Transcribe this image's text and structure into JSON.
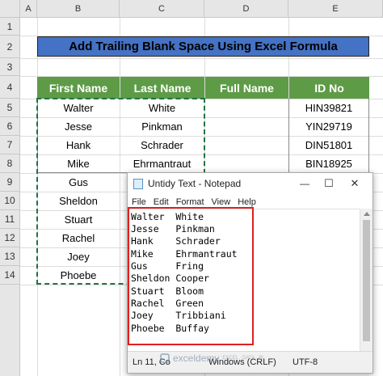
{
  "sheet": {
    "columns": [
      "A",
      "B",
      "C",
      "D",
      "E"
    ],
    "rows": [
      "1",
      "2",
      "3",
      "4",
      "5",
      "6",
      "7",
      "8",
      "9",
      "10",
      "11",
      "12",
      "13",
      "14"
    ],
    "banner": "Add Trailing Blank Space Using Excel Formula",
    "headers": [
      "First Name",
      "Last Name",
      "Full Name",
      "ID No"
    ],
    "data": [
      {
        "first": "Walter",
        "last": "White",
        "id": "HIN39821"
      },
      {
        "first": "Jesse",
        "last": "Pinkman",
        "id": "YIN29719"
      },
      {
        "first": "Hank",
        "last": "Schrader",
        "id": "DIN51801"
      },
      {
        "first": "Mike",
        "last": "Ehrmantraut",
        "id": "BIN18925"
      },
      {
        "first": "Gus",
        "last": "",
        "id": ""
      },
      {
        "first": "Sheldon",
        "last": "",
        "id": ""
      },
      {
        "first": "Stuart",
        "last": "",
        "id": ""
      },
      {
        "first": "Rachel",
        "last": "",
        "id": ""
      },
      {
        "first": "Joey",
        "last": "",
        "id": ""
      },
      {
        "first": "Phoebe",
        "last": "",
        "id": ""
      }
    ],
    "colors": {
      "header_green": "#5e9b47",
      "banner_blue": "#4472c4"
    }
  },
  "notepad": {
    "title": "Untidy Text - Notepad",
    "icon": "notepad-icon",
    "controls": {
      "minimize": "—",
      "maximize": "☐",
      "close": "✕"
    },
    "menu": [
      "File",
      "Edit",
      "Format",
      "View",
      "Help"
    ],
    "lines": [
      "Walter  White",
      "Jesse   Pinkman",
      "Hank    Schrader",
      "Mike    Ehrmantraut",
      "Gus     Fring",
      "Sheldon Cooper",
      "Stuart  Bloom",
      "Rachel  Green",
      "Joey    Tribbiani",
      "Phoebe  Buffay"
    ],
    "status": {
      "position": "Ln 11, Co",
      "line_ending": "Windows (CRLF)",
      "encoding": "UTF-8"
    },
    "highlight_color": "#e02020"
  },
  "watermark": {
    "name": "exceldemy",
    "tagline": "EXCEL · DATA · BI"
  }
}
